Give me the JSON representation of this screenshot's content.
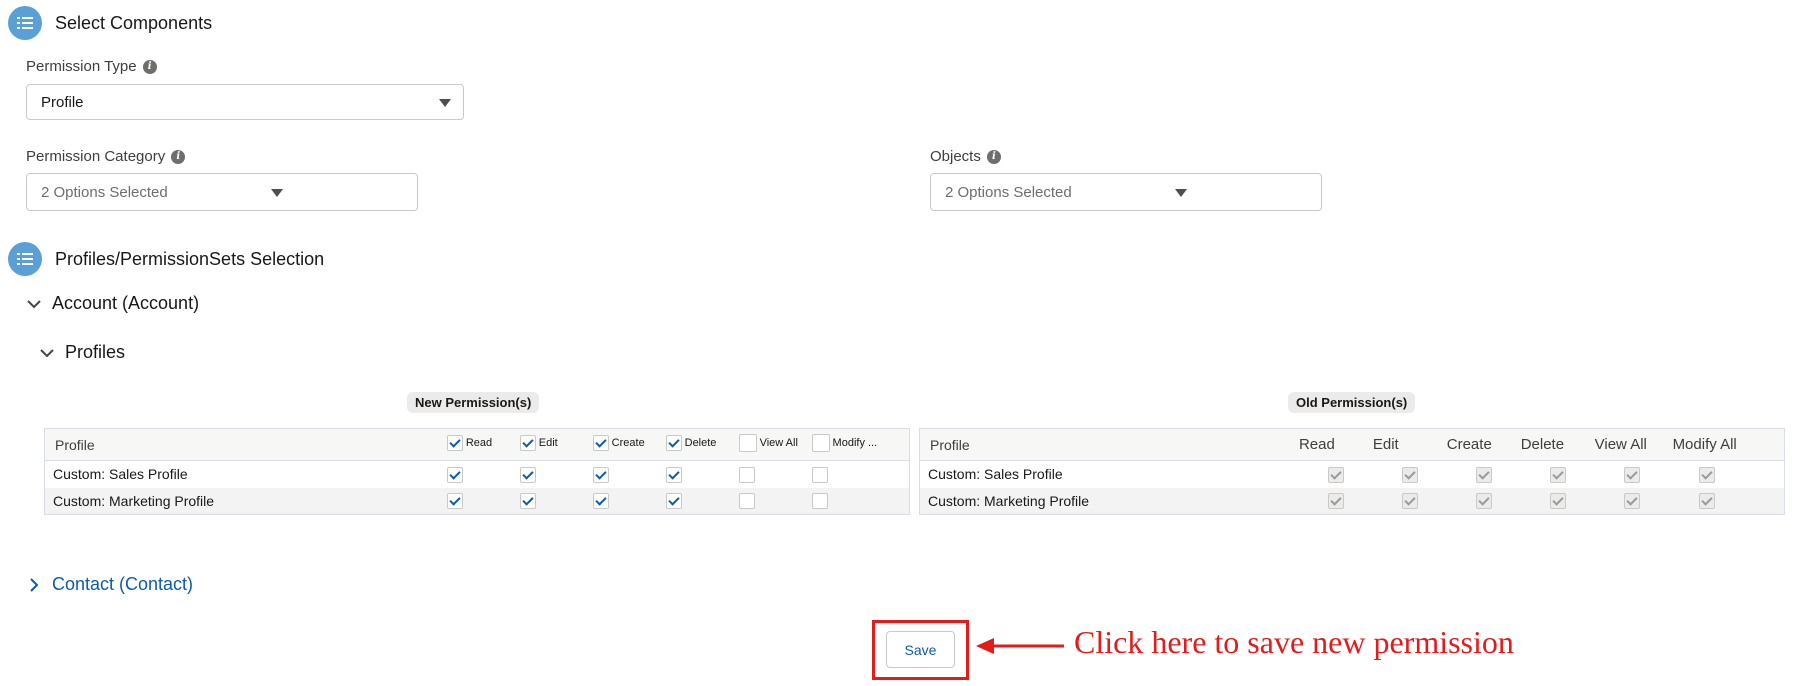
{
  "section1": {
    "title": "Select Components"
  },
  "permission_type": {
    "label": "Permission Type",
    "value": "Profile"
  },
  "permission_category": {
    "label": "Permission Category",
    "value": "2 Options Selected"
  },
  "objects": {
    "label": "Objects",
    "value": "2 Options Selected"
  },
  "section2": {
    "title": "Profiles/PermissionSets Selection"
  },
  "tree": {
    "account": "Account (Account)",
    "profiles": "Profiles",
    "contact": "Contact (Contact)"
  },
  "new_perm": {
    "title": "New Permission(s)",
    "col_profile": "Profile",
    "cols": [
      "Read",
      "Edit",
      "Create",
      "Delete",
      "View All",
      "Modify ..."
    ],
    "header_checked": [
      true,
      true,
      true,
      true,
      false,
      false
    ],
    "rows": [
      {
        "name": "Custom: Sales Profile",
        "checks": [
          true,
          true,
          true,
          true,
          false,
          false
        ]
      },
      {
        "name": "Custom: Marketing Profile",
        "checks": [
          true,
          true,
          true,
          true,
          false,
          false
        ]
      }
    ]
  },
  "old_perm": {
    "title": "Old Permission(s)",
    "col_profile": "Profile",
    "cols": [
      "Read",
      "Edit",
      "Create",
      "Delete",
      "View All",
      "Modify All"
    ],
    "rows": [
      {
        "name": "Custom: Sales Profile",
        "checks": [
          true,
          true,
          true,
          true,
          true,
          true
        ]
      },
      {
        "name": "Custom: Marketing Profile",
        "checks": [
          true,
          true,
          true,
          true,
          true,
          true
        ]
      }
    ]
  },
  "save": {
    "label": "Save"
  },
  "annotation": {
    "text": "Click here to save new permission"
  },
  "colors": {
    "accent": "#0b5cab",
    "section_icon": "#5aa0d6",
    "annotation": "#e31b1b"
  },
  "icons": {
    "section": "list-icon",
    "info": "info-icon",
    "chevron_down": "chevron-down-icon",
    "chevron_right": "chevron-right-icon",
    "arrow": "arrow-left-icon"
  }
}
